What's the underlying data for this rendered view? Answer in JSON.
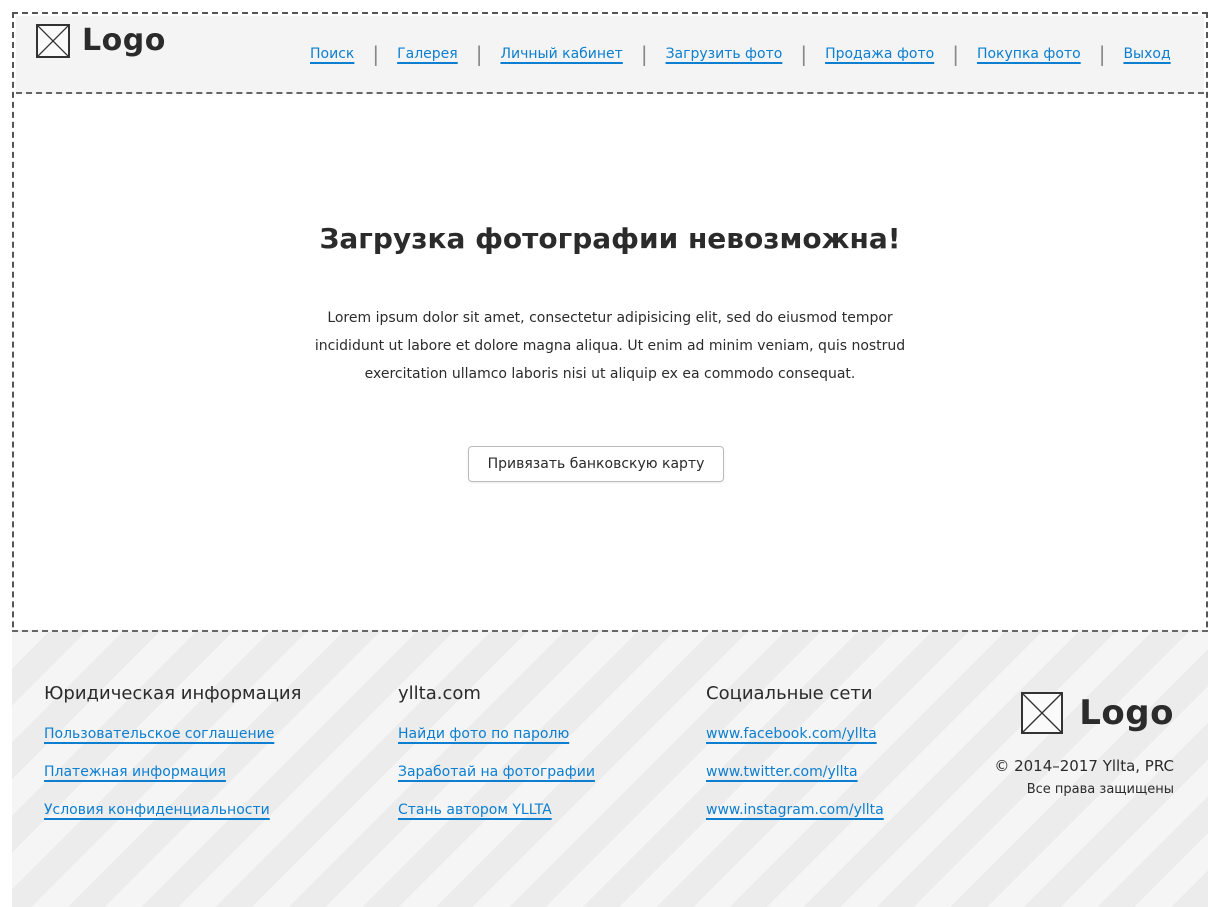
{
  "header": {
    "logo_text": "Logo",
    "nav": [
      {
        "label": "Поиск"
      },
      {
        "label": "Галерея"
      },
      {
        "label": "Личный кабинет"
      },
      {
        "label": "Загрузить фото"
      },
      {
        "label": "Продажа фото"
      },
      {
        "label": "Покупка фото"
      },
      {
        "label": "Выход"
      }
    ],
    "separator": "|"
  },
  "main": {
    "title": "Загрузка фотографии невозможна!",
    "description": "Lorem ipsum dolor sit amet, consectetur adipisicing elit, sed do eiusmod tempor incididunt ut labore et dolore magna aliqua. Ut enim ad minim veniam, quis nostrud exercitation ullamco laboris nisi ut aliquip ex ea commodo consequat.",
    "button_label": "Привязать банковскую карту"
  },
  "footer": {
    "legal": {
      "title": "Юридическая информация",
      "links": [
        "Пользовательское соглашение",
        "Платежная информация",
        "Условия конфиденциальности"
      ]
    },
    "site": {
      "title": "yllta.com",
      "links": [
        "Найди фото по паролю",
        "Заработай на фотографии",
        "Стань автором YLLTA"
      ]
    },
    "social": {
      "title": "Социальные сети",
      "links": [
        "www.facebook.com/yllta",
        "www.twitter.com/yllta",
        "www.instagram.com/yllta"
      ]
    },
    "brand": {
      "logo_text": "Logo",
      "copyright": "© 2014–2017 Yllta, PRC",
      "rights": "Все права защищены"
    }
  },
  "colors": {
    "link": "#0c7fd0",
    "text": "#2b2b2b",
    "header_bg": "#f4f4f4",
    "footer_bg": "#f5f5f5"
  }
}
